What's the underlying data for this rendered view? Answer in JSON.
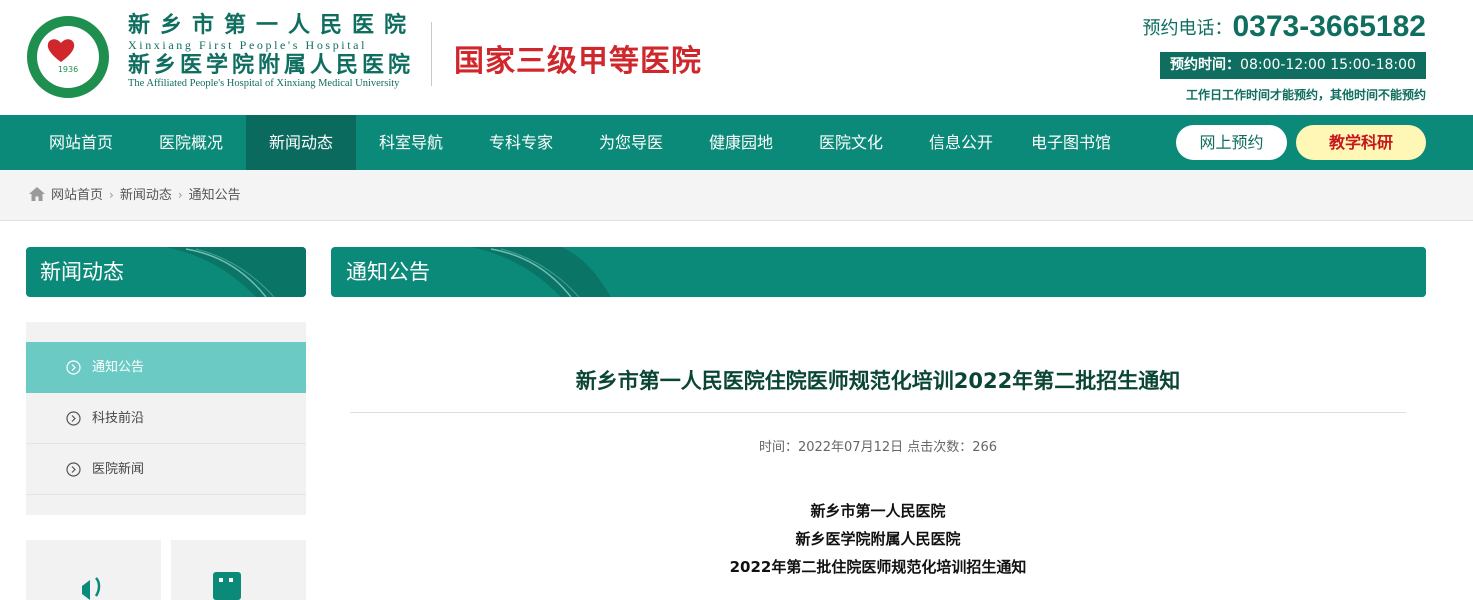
{
  "header": {
    "logo_year": "1936",
    "hospital_name_cn": "新乡市第一人民医院",
    "hospital_name_en": "Xinxiang First People's Hospital",
    "affiliated_name_cn": "新乡医学院附属人民医院",
    "affiliated_name_en": "The Affiliated People's Hospital of Xinxiang Medical University",
    "grade": "国家三级甲等医院",
    "phone_label": "预约电话：",
    "phone_number": "0373-3665182",
    "hours_label": "预约时间：",
    "hours_value": "08:00-12:00  15:00-18:00",
    "hours_note": "工作日工作时间才能预约，其他时间不能预约"
  },
  "nav": {
    "items": [
      {
        "label": "网站首页"
      },
      {
        "label": "医院概况"
      },
      {
        "label": "新闻动态"
      },
      {
        "label": "科室导航"
      },
      {
        "label": "专科专家"
      },
      {
        "label": "为您导医"
      },
      {
        "label": "健康园地"
      },
      {
        "label": "医院文化"
      },
      {
        "label": "信息公开"
      },
      {
        "label": "电子图书馆"
      }
    ],
    "active_index": 2,
    "online_booking": "网上预约",
    "teaching_research": "教学科研"
  },
  "breadcrumb": [
    "网站首页",
    "新闻动态",
    "通知公告"
  ],
  "sidebar": {
    "title": "新闻动态",
    "items": [
      {
        "label": "通知公告",
        "active": true
      },
      {
        "label": "科技前沿",
        "active": false
      },
      {
        "label": "医院新闻",
        "active": false
      }
    ]
  },
  "main": {
    "section_title": "通知公告",
    "article_title": "新乡市第一人民医院住院医师规范化培训2022年第二批招生通知",
    "meta": "时间：2022年07月12日 点击次数：266",
    "body_lines": [
      "新乡市第一人民医院",
      "新乡医学院附属人民医院",
      "2022年第二批住院医师规范化培训招生通知"
    ]
  },
  "colors": {
    "primary": "#0b8a79",
    "nav_active": "#0a6a5e",
    "dark_green": "#0f6e5f",
    "sidebar_active": "#6ccac5",
    "grade_red": "#d0272c",
    "pill_yellow": "#fff7b5"
  },
  "icons": {
    "home": "home-icon",
    "arrow": "circle-arrow-right-icon",
    "heart": "heart-icon"
  }
}
